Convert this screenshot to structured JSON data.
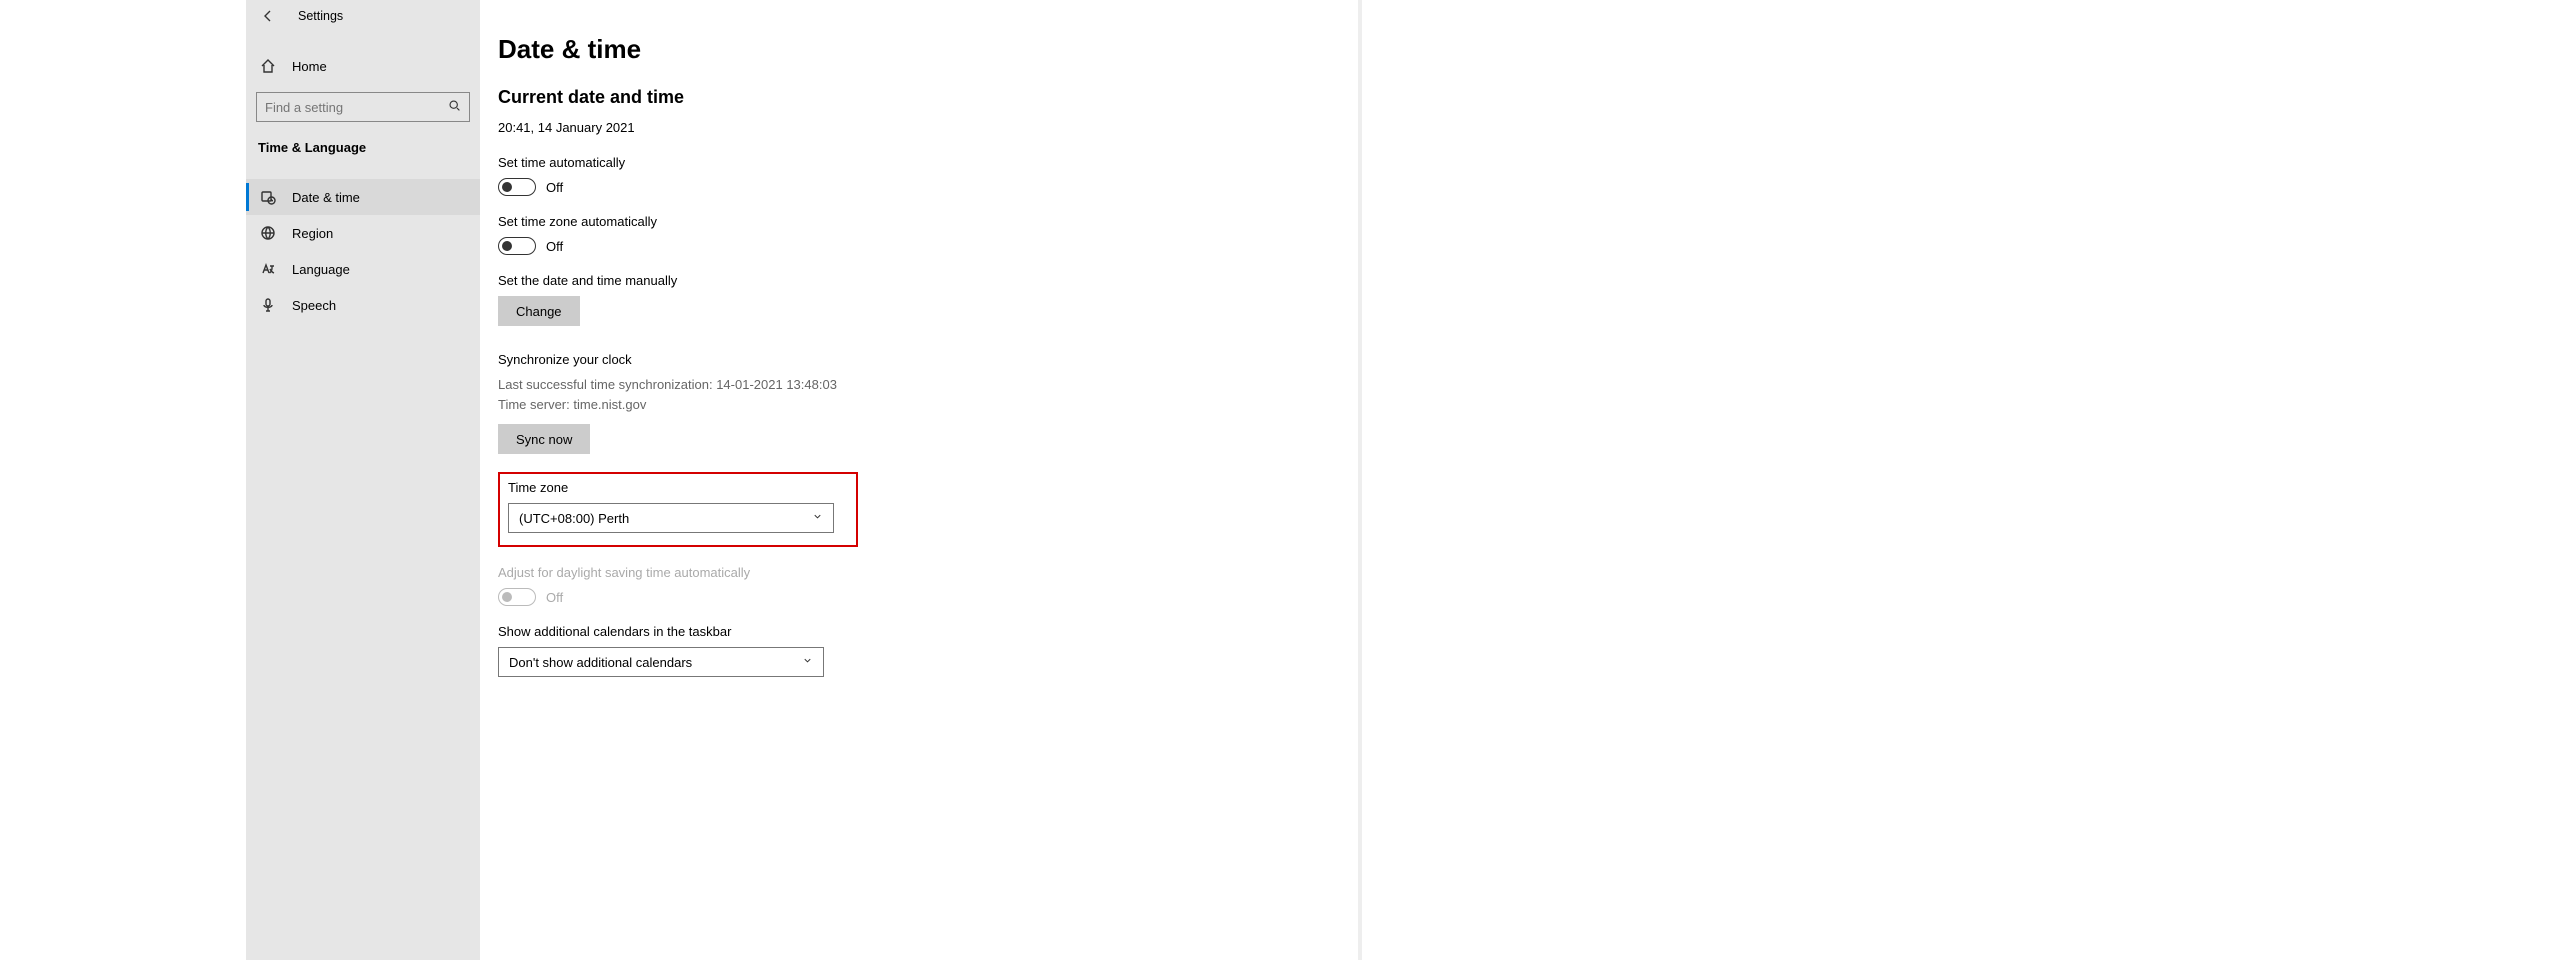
{
  "topbar": {
    "title": "Settings"
  },
  "sidebar": {
    "home_label": "Home",
    "search_placeholder": "Find a setting",
    "category_label": "Time & Language",
    "items": [
      {
        "label": "Date & time"
      },
      {
        "label": "Region"
      },
      {
        "label": "Language"
      },
      {
        "label": "Speech"
      }
    ]
  },
  "page": {
    "title": "Date & time",
    "current_section": "Current date and time",
    "current_value": "20:41, 14 January 2021",
    "set_time_auto": {
      "label": "Set time automatically",
      "state": "Off"
    },
    "set_tz_auto": {
      "label": "Set time zone automatically",
      "state": "Off"
    },
    "manual": {
      "label": "Set the date and time manually",
      "button": "Change"
    },
    "sync": {
      "label": "Synchronize your clock",
      "last": "Last successful time synchronization: 14-01-2021 13:48:03",
      "server": "Time server: time.nist.gov",
      "button": "Sync now"
    },
    "timezone": {
      "label": "Time zone",
      "value": "(UTC+08:00) Perth"
    },
    "dst": {
      "label": "Adjust for daylight saving time automatically",
      "state": "Off"
    },
    "calendars": {
      "label": "Show additional calendars in the taskbar",
      "value": "Don't show additional calendars"
    }
  }
}
